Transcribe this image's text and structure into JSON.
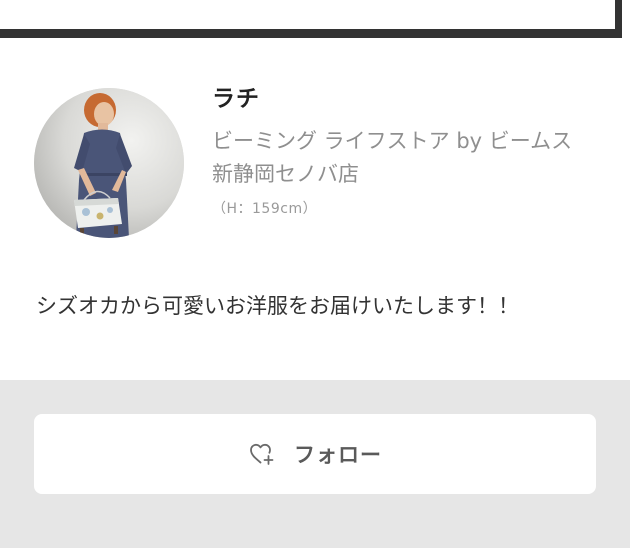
{
  "profile": {
    "name": "ラチ",
    "shop": "ビーミング ライフストア by ビームス 新静岡セノバ店",
    "height": "（H：159cm）",
    "bio": "シズオカから可愛いお洋服をお届けいたします！！"
  },
  "actions": {
    "follow_label": "フォロー",
    "follow_icon": "heart-plus-icon"
  },
  "colors": {
    "footer_background": "#e6e6e6",
    "button_background": "#ffffff",
    "secondary_text": "#8f8f8f"
  }
}
